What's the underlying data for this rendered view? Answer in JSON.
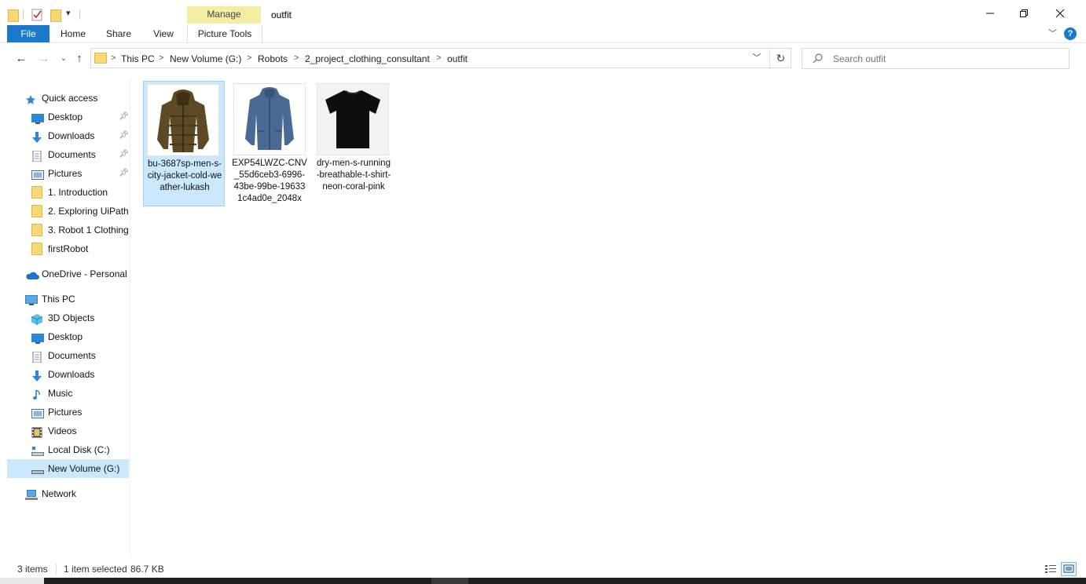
{
  "window": {
    "title": "outfit",
    "contextual_tab_group": "Manage",
    "controls": {
      "minimize_icon": "minimize-icon",
      "restore_icon": "restore-icon",
      "close_icon": "close-icon"
    }
  },
  "ribbon": {
    "tabs": [
      {
        "label": "File"
      },
      {
        "label": "Home"
      },
      {
        "label": "Share"
      },
      {
        "label": "View"
      },
      {
        "label": "Picture Tools"
      }
    ],
    "help_label": "?"
  },
  "address": {
    "breadcrumbs": [
      "This PC",
      "New Volume (G:)",
      "Robots",
      "2_project_clothing_consultant",
      "outfit"
    ],
    "separator": ">"
  },
  "search": {
    "placeholder": "Search outfit",
    "value": ""
  },
  "nav": {
    "items": [
      {
        "label": "Quick access",
        "icon": "star-icon"
      },
      {
        "label": "Desktop",
        "icon": "desktop-icon",
        "pinned": true
      },
      {
        "label": "Downloads",
        "icon": "download-arrow-icon",
        "pinned": true
      },
      {
        "label": "Documents",
        "icon": "documents-icon",
        "pinned": true
      },
      {
        "label": "Pictures",
        "icon": "pictures-icon",
        "pinned": true
      },
      {
        "label": "1. Introduction",
        "icon": "folder-icon"
      },
      {
        "label": "2. Exploring UiPath",
        "icon": "folder-icon"
      },
      {
        "label": "3. Robot 1 Clothing",
        "icon": "folder-icon"
      },
      {
        "label": "firstRobot",
        "icon": "folder-icon"
      },
      {
        "label": "OneDrive - Personal",
        "icon": "cloud-icon"
      },
      {
        "label": "This PC",
        "icon": "computer-icon"
      },
      {
        "label": "3D Objects",
        "icon": "cube-icon"
      },
      {
        "label": "Desktop",
        "icon": "desktop-icon"
      },
      {
        "label": "Documents",
        "icon": "documents-icon"
      },
      {
        "label": "Downloads",
        "icon": "download-arrow-icon"
      },
      {
        "label": "Music",
        "icon": "music-note-icon"
      },
      {
        "label": "Pictures",
        "icon": "pictures-icon"
      },
      {
        "label": "Videos",
        "icon": "film-icon"
      },
      {
        "label": "Local Disk (C:)",
        "icon": "drive-icon"
      },
      {
        "label": "New Volume (G:)",
        "icon": "drive-icon",
        "selected": true
      },
      {
        "label": "Network",
        "icon": "network-icon"
      }
    ]
  },
  "files": [
    {
      "name": "bu-3687sp-men-s-city-jacket-cold-weather-lukash",
      "thumb": "puffer-jacket-thumbnail",
      "selected": true
    },
    {
      "name": "EXP54LWZC-CNV_55d6ceb3-6996-43be-99be-196331c4ad0e_2048x",
      "thumb": "windbreaker-thumbnail"
    },
    {
      "name": "dry-men-s-running-breathable-t-shirt-neon-coral-pink",
      "thumb": "black-tshirt-thumbnail"
    }
  ],
  "status": {
    "item_count": "3 items",
    "selection": "1 item selected",
    "size": "86.7 KB"
  },
  "colors": {
    "accent": "#1979ca",
    "selection": "#cce8ff",
    "manage_tab": "#f3eea2"
  }
}
